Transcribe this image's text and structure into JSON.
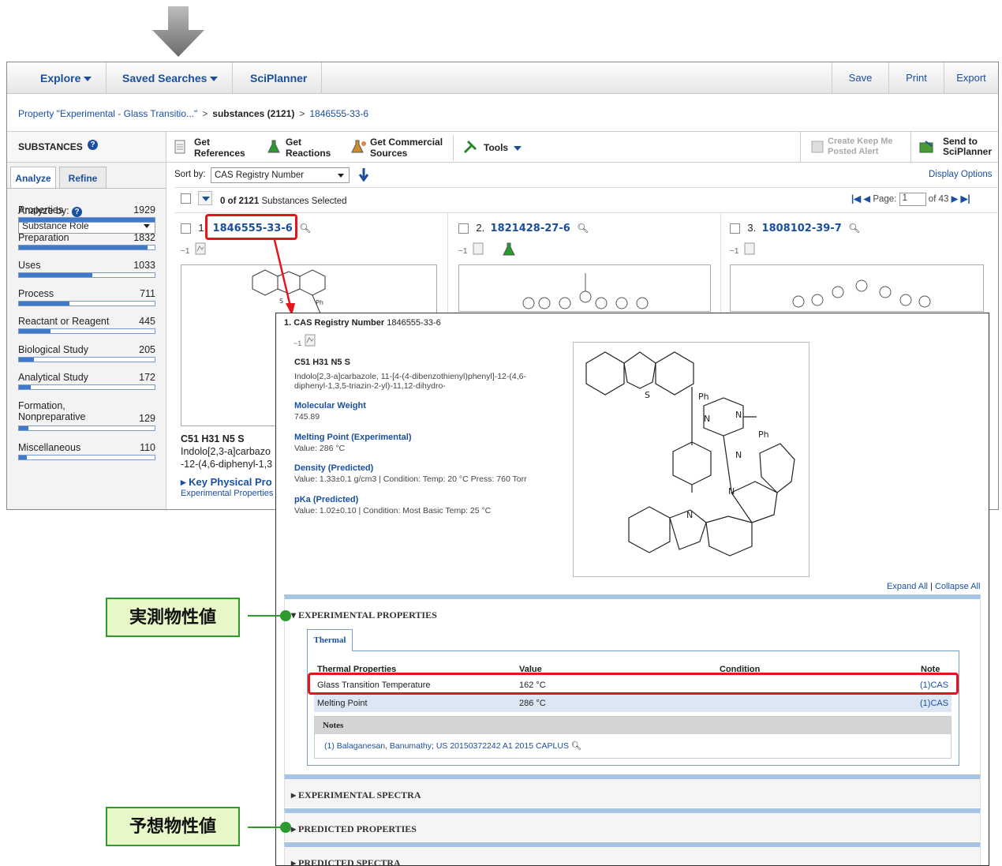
{
  "nav": {
    "explore": "Explore",
    "saved_searches": "Saved Searches",
    "sciplanner": "SciPlanner",
    "save": "Save",
    "print": "Print",
    "export": "Export"
  },
  "breadcrumb": {
    "query": "Property \"Experimental - Glass Transitio...\"",
    "sep1": ">",
    "substances": "substances (2121)",
    "sep2": ">",
    "cas": "1846555-33-6"
  },
  "toolbar": {
    "substances": "SUBSTANCES",
    "get_references_1": "Get",
    "get_references_2": "References",
    "get_reactions_1": "Get",
    "get_reactions_2": "Reactions",
    "get_commercial_1": "Get Commercial",
    "get_commercial_2": "Sources",
    "tools": "Tools",
    "keep_me_1": "Create Keep Me",
    "keep_me_2": "Posted Alert",
    "send_to_1": "Send to",
    "send_to_2": "SciPlanner"
  },
  "sidebar": {
    "tab_analyze": "Analyze",
    "tab_refine": "Refine",
    "analyze_by": "Analyze by:",
    "dropdown": "Substance Role",
    "items": [
      {
        "label": "Properties",
        "count": "1929",
        "fill": 1.0
      },
      {
        "label": "Preparation",
        "count": "1832",
        "fill": 0.95
      },
      {
        "label": "Uses",
        "count": "1033",
        "fill": 0.54
      },
      {
        "label": "Process",
        "count": "711",
        "fill": 0.37
      },
      {
        "label": "Reactant or Reagent",
        "count": "445",
        "fill": 0.23
      },
      {
        "label": "Biological Study",
        "count": "205",
        "fill": 0.11
      },
      {
        "label": "Analytical Study",
        "count": "172",
        "fill": 0.09
      },
      {
        "label": "Formation,",
        "label2": "Nonpreparative",
        "count": "129",
        "fill": 0.07
      },
      {
        "label": "Miscellaneous",
        "count": "110",
        "fill": 0.06
      }
    ]
  },
  "results": {
    "sort_by": "Sort by:",
    "sort_value": "CAS Registry Number",
    "display_options": "Display Options",
    "selected": "0 of 2121",
    "selected_suffix": "Substances Selected",
    "page_label": "Page:",
    "page_value": "1",
    "page_of": "of 43",
    "cards": [
      {
        "num": "1.",
        "cas": "1846555-33-6",
        "ref": "~1"
      },
      {
        "num": "2.",
        "cas": "1821428-27-6",
        "ref": "~1"
      },
      {
        "num": "3.",
        "cas": "1808102-39-7",
        "ref": "~1"
      }
    ],
    "card1_formula": "C51 H31 N5 S",
    "card1_name_1": "Indolo[2,3-a]carbazo",
    "card1_name_2": "-12-(4,6-diphenyl-1,3",
    "card1_kpp": "Key Physical Pro",
    "card1_exp": "Experimental Properties"
  },
  "popup": {
    "header_num": "1. CAS Registry Number",
    "header_cas": "1846555-33-6",
    "ref": "~1",
    "formula": "C51 H31 N5 S",
    "name": "Indolo[2,3-a]carbazole, 11-[4-(4-dibenzothienyl)phenyl]-12-(4,6-diphenyl-1,3,5-triazin-2-yl)-11,12-dihydro-",
    "mw_label": "Molecular Weight",
    "mw_value": "745.89",
    "mp_label": "Melting Point (Experimental)",
    "mp_value": "Value: 286 °C",
    "density_label": "Density (Predicted)",
    "density_value": "Value: 1.33±0.1 g/cm3 | Condition: Temp: 20 °C Press: 760 Torr",
    "pka_label": "pKa (Predicted)",
    "pka_value": "Value: 1.02±0.10 | Condition: Most Basic Temp: 25 °C",
    "expand_all": "Expand All",
    "collapse_sep": "|",
    "collapse_all": "Collapse All",
    "sec_exp_props": "EXPERIMENTAL PROPERTIES",
    "tab_thermal": "Thermal",
    "table_headers": [
      "Thermal Properties",
      "Value",
      "Condition",
      "Note"
    ],
    "table_rows": [
      {
        "prop": "Glass Transition Temperature",
        "value": "162 °C",
        "cond": "",
        "note": "(1)CAS"
      },
      {
        "prop": "Melting Point",
        "value": "286 °C",
        "cond": "",
        "note": "(1)CAS"
      }
    ],
    "notes_label": "Notes",
    "note_1": "(1) Balaganesan, Banumathy; US 20150372242 A1 2015 CAPLUS",
    "sec_exp_spectra": "EXPERIMENTAL SPECTRA",
    "sec_pred_props": "PREDICTED PROPERTIES",
    "sec_pred_spectra": "PREDICTED SPECTRA",
    "ph1": "Ph",
    "ph2": "Ph",
    "s": "S",
    "n": "N"
  },
  "annotations": {
    "measured": "実測物性値",
    "predicted": "予想物性値"
  },
  "colors": {
    "link": "#1a4fa0",
    "highlight": "#e3161b",
    "annotation": "#2e9a2e",
    "section_bar": "#a6c4e4"
  }
}
